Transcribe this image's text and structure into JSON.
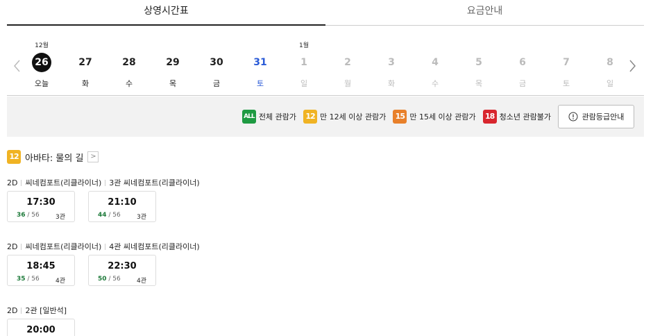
{
  "tabs": [
    {
      "label": "상영시간표",
      "active": true
    },
    {
      "label": "요금안내",
      "active": false
    }
  ],
  "dates": [
    {
      "month": "12월",
      "num": "26",
      "weekday": "오늘",
      "state": "today"
    },
    {
      "month": "",
      "num": "27",
      "weekday": "화",
      "state": "normal"
    },
    {
      "month": "",
      "num": "28",
      "weekday": "수",
      "state": "normal"
    },
    {
      "month": "",
      "num": "29",
      "weekday": "목",
      "state": "normal"
    },
    {
      "month": "",
      "num": "30",
      "weekday": "금",
      "state": "normal"
    },
    {
      "month": "",
      "num": "31",
      "weekday": "토",
      "state": "sat"
    },
    {
      "month": "1월",
      "num": "1",
      "weekday": "일",
      "state": "disabled"
    },
    {
      "month": "",
      "num": "2",
      "weekday": "월",
      "state": "disabled"
    },
    {
      "month": "",
      "num": "3",
      "weekday": "화",
      "state": "disabled"
    },
    {
      "month": "",
      "num": "4",
      "weekday": "수",
      "state": "disabled"
    },
    {
      "month": "",
      "num": "5",
      "weekday": "목",
      "state": "disabled"
    },
    {
      "month": "",
      "num": "6",
      "weekday": "금",
      "state": "disabled"
    },
    {
      "month": "",
      "num": "7",
      "weekday": "토",
      "state": "disabled"
    },
    {
      "month": "",
      "num": "8",
      "weekday": "일",
      "state": "disabled"
    }
  ],
  "legend": {
    "all": {
      "badge": "ALL",
      "label": "전체 관람가"
    },
    "r12": {
      "badge": "12",
      "label": "만 12세 이상 관람가"
    },
    "r15": {
      "badge": "15",
      "label": "만 15세 이상 관람가"
    },
    "r18": {
      "badge": "18",
      "label": "청소년 관람불가"
    },
    "guide_button": "관람등급안내"
  },
  "movie": {
    "rating": "12",
    "title": "아바타: 물의 길",
    "detail_arrow": ">"
  },
  "groups": [
    {
      "format": "2D",
      "parts": [
        "씨네컴포트(리클라이너)",
        "3관 씨네컴포트(리클라이너)"
      ],
      "slots": [
        {
          "time": "17:30",
          "available": "36",
          "total": "56",
          "hall": "3관"
        },
        {
          "time": "21:10",
          "available": "44",
          "total": "56",
          "hall": "3관"
        }
      ]
    },
    {
      "format": "2D",
      "parts": [
        "씨네컴포트(리클라이너)",
        "4관 씨네컴포트(리클라이너)"
      ],
      "slots": [
        {
          "time": "18:45",
          "available": "35",
          "total": "56",
          "hall": "4관"
        },
        {
          "time": "22:30",
          "available": "50",
          "total": "56",
          "hall": "4관"
        }
      ]
    },
    {
      "format": "2D",
      "parts": [
        "2관 [일반석]"
      ],
      "slots": [
        {
          "time": "20:00",
          "available": "",
          "total": "",
          "hall": ""
        }
      ]
    }
  ],
  "colors": {
    "saturday": "#2a5bd7",
    "available_seats": "#1e7a3a",
    "rating_all": "#1e9a42",
    "rating_12": "#f0b323",
    "rating_15": "#e8802a",
    "rating_18": "#d8262e"
  }
}
